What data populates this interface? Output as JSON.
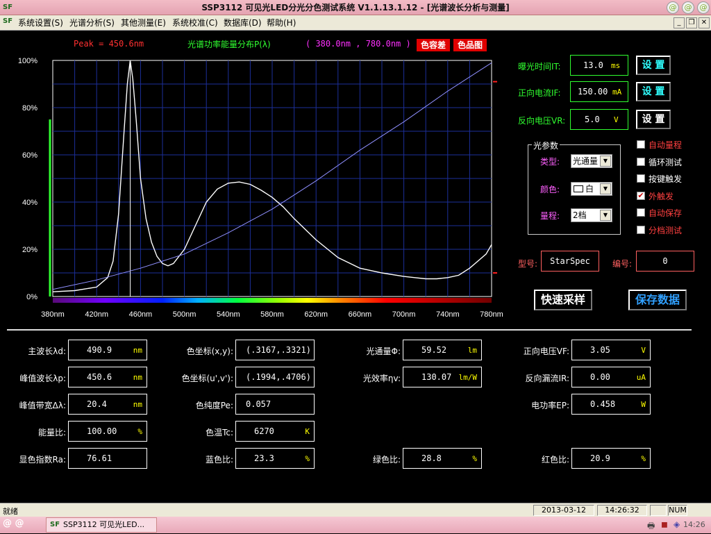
{
  "title": {
    "text": "SSP3112 可见光LED分光分色测试系统 V1.1.13.1.12 - [光谱波长分析与测量]",
    "icon": "app-logo-icon"
  },
  "menu": [
    {
      "label": "系统设置(S)"
    },
    {
      "label": "光谱分析(S)"
    },
    {
      "label": "其他测量(E)"
    },
    {
      "label": "系统校准(C)"
    },
    {
      "label": "数据库(D)"
    },
    {
      "label": "帮助(H)"
    }
  ],
  "chart_header": {
    "peak": "Peak = 450.6nm",
    "label": "光谱功率能量分布P(λ)",
    "range": "( 380.0nm , 780.0nm )",
    "btn_color_tol": "色容差",
    "btn_color_chart": "色品图"
  },
  "chart_data": {
    "type": "line",
    "x_ticks": [
      "380nm",
      "420nm",
      "460nm",
      "500nm",
      "540nm",
      "580nm",
      "620nm",
      "660nm",
      "700nm",
      "740nm",
      "780nm"
    ],
    "y_ticks": [
      "100%",
      "80%",
      "60%",
      "40%",
      "20%",
      "0%"
    ],
    "xlim": [
      380,
      780
    ],
    "ylim": [
      0,
      100
    ],
    "grid": true,
    "peak_marker_nm": 450.6,
    "series": [
      {
        "color": "#ffffff",
        "x": [
          380,
          400,
          420,
          430,
          435,
          440,
          445,
          448,
          450.6,
          453,
          456,
          460,
          465,
          470,
          475,
          480,
          485,
          490,
          500,
          510,
          520,
          530,
          540,
          550,
          560,
          570,
          580,
          590,
          600,
          620,
          640,
          660,
          680,
          700,
          710,
          720,
          730,
          740,
          750,
          760,
          770,
          775,
          780
        ],
        "y": [
          2,
          2.5,
          4,
          8,
          15,
          35,
          70,
          90,
          100,
          92,
          75,
          50,
          33,
          23,
          17,
          14,
          13,
          14,
          20,
          30,
          40,
          45.5,
          48,
          48.5,
          47.5,
          45,
          42,
          38,
          33,
          24,
          16.5,
          12,
          10,
          8.5,
          8,
          7.5,
          7.5,
          8,
          9,
          12,
          16,
          18,
          22
        ]
      },
      {
        "color": "#9090ff",
        "x": [
          380,
          420,
          460,
          500,
          540,
          580,
          620,
          660,
          700,
          740,
          780
        ],
        "y": [
          3,
          7,
          12,
          18,
          27,
          37,
          49,
          62,
          74,
          87,
          99
        ]
      }
    ]
  },
  "controls": {
    "exposure": {
      "label": "曝光时间IT:",
      "value": "13.0",
      "unit": "ms",
      "btn": "设 置"
    },
    "forward_current": {
      "label": "正向电流IF:",
      "value": "150.00",
      "unit": "mA",
      "btn": "设 置"
    },
    "reverse_voltage": {
      "label": "反向电压VR:",
      "value": "5.0",
      "unit": "V",
      "btn": "设 置"
    }
  },
  "light_params": {
    "group_label": "光参数",
    "type_label": "类型:",
    "type_value": "光通量",
    "color_label": "颜色:",
    "color_value": "白",
    "range_label": "量程:",
    "range_value": "2档"
  },
  "checkboxes": [
    {
      "label": "自动量程",
      "checked": false,
      "color": "#ff4040"
    },
    {
      "label": "循环测试",
      "checked": false,
      "color": "#ffffff"
    },
    {
      "label": "按键触发",
      "checked": false,
      "color": "#ffffff"
    },
    {
      "label": "外触发",
      "checked": true,
      "color": "#ff4040"
    },
    {
      "label": "自动保存",
      "checked": false,
      "color": "#ff4040"
    },
    {
      "label": "分档测试",
      "checked": false,
      "color": "#ff4040"
    }
  ],
  "model": {
    "label": "型号:",
    "value": "StarSpec"
  },
  "serial": {
    "label": "编号:",
    "value": "0"
  },
  "quick_sample_btn": "快速采样",
  "save_data_btn": "保存数据",
  "results": {
    "dominant_wl": {
      "label": "主波长λd:",
      "value": "490.9",
      "unit": "nm"
    },
    "peak_wl": {
      "label": "峰值波长λp:",
      "value": "450.6",
      "unit": "nm"
    },
    "fwhm": {
      "label": "峰值带宽Δλ:",
      "value": "20.4",
      "unit": "nm"
    },
    "energy_ratio": {
      "label": "能量比:",
      "value": "100.00",
      "unit": "%"
    },
    "cri": {
      "label": "显色指数Ra:",
      "value": "76.61",
      "unit": ""
    },
    "xy": {
      "label": "色坐标(x,y):",
      "value": "(.3167,.3321)"
    },
    "uv": {
      "label": "色坐标(u',v'):",
      "value": "(.1994,.4706)"
    },
    "purity": {
      "label": "色纯度Pe:",
      "value": "0.057"
    },
    "cct": {
      "label": "色温Tc:",
      "value": "6270",
      "unit": "K"
    },
    "blue_ratio": {
      "label": "蓝色比:",
      "value": "23.3",
      "unit": "%"
    },
    "flux": {
      "label": "光通量Φ:",
      "value": "59.52",
      "unit": "lm"
    },
    "efficacy": {
      "label": "光效率ηv:",
      "value": "130.07",
      "unit": "lm/W"
    },
    "green_ratio": {
      "label": "绿色比:",
      "value": "28.8",
      "unit": "%"
    },
    "vf": {
      "label": "正向电压VF:",
      "value": "3.05",
      "unit": "V"
    },
    "ir": {
      "label": "反向漏流IR:",
      "value": "0.00",
      "unit": "uA"
    },
    "power": {
      "label": "电功率EP:",
      "value": "0.458",
      "unit": "W"
    },
    "red_ratio": {
      "label": "红色比:",
      "value": "20.9",
      "unit": "%"
    }
  },
  "status": {
    "ready": "就绪",
    "date": "2013-03-12",
    "time": "14:26:32",
    "num": "NUM"
  },
  "taskbar": {
    "window_label": "SSP3112 可见光LED...",
    "clock": "14:26"
  }
}
